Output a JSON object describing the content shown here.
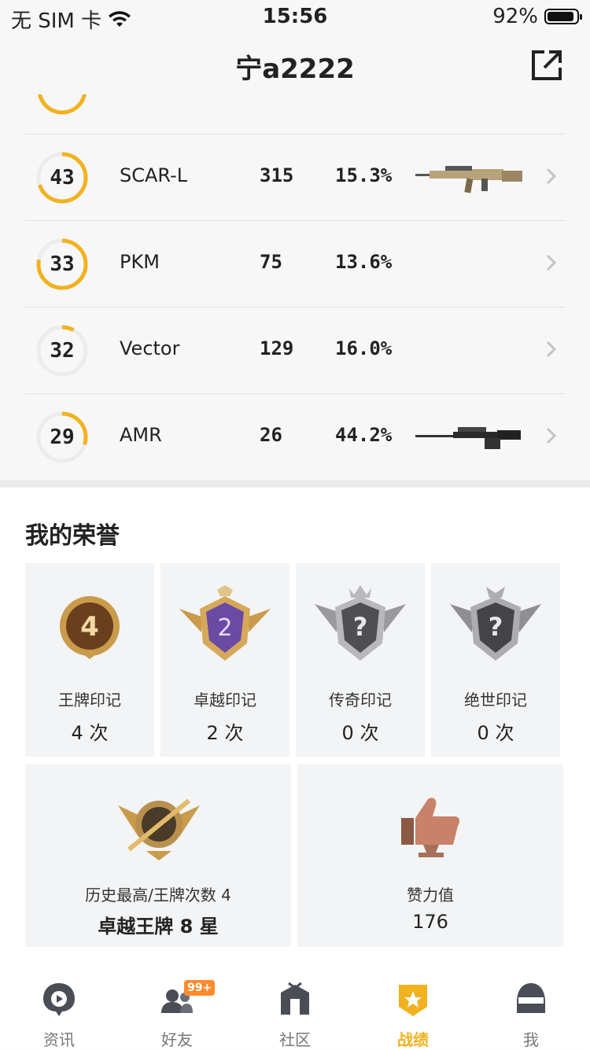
{
  "status_bar": {
    "carrier": "无 SIM 卡",
    "time": "15:56",
    "battery": "92%",
    "battery_level": 0.92
  },
  "header": {
    "title": "宁a2222"
  },
  "weapons": [
    {
      "level": "43",
      "progress": 0.7,
      "name": "SCAR-L",
      "count": "315",
      "rate": "15.3%",
      "has_image": true
    },
    {
      "level": "33",
      "progress": 0.78,
      "name": "PKM",
      "count": "75",
      "rate": "13.6%",
      "has_image": false
    },
    {
      "level": "32",
      "progress": 0.08,
      "name": "Vector",
      "count": "129",
      "rate": "16.0%",
      "has_image": false
    },
    {
      "level": "29",
      "progress": 0.3,
      "name": "AMR",
      "count": "26",
      "rate": "44.2%",
      "has_image": true
    }
  ],
  "honors": {
    "title": "我的荣誉",
    "marks": [
      {
        "label": "王牌印记",
        "value": "4 次",
        "badge_text": "4"
      },
      {
        "label": "卓越印记",
        "value": "2 次",
        "badge_text": "2"
      },
      {
        "label": "传奇印记",
        "value": "0 次",
        "badge_text": "?"
      },
      {
        "label": "绝世印记",
        "value": "0 次",
        "badge_text": "?"
      }
    ],
    "best": {
      "label": "历史最高/王牌次数 4",
      "value": "卓越王牌 8 星"
    },
    "likes": {
      "label": "赞力值",
      "value": "176"
    }
  },
  "tabbar": {
    "tabs": [
      {
        "label": "资讯",
        "icon": "news-icon"
      },
      {
        "label": "好友",
        "icon": "friends-icon",
        "badge": "99+"
      },
      {
        "label": "社区",
        "icon": "community-icon"
      },
      {
        "label": "战绩",
        "icon": "record-icon"
      },
      {
        "label": "我",
        "icon": "profile-icon"
      }
    ],
    "active": "战绩"
  },
  "colors": {
    "accent": "#f2b21f",
    "text": "#222222"
  }
}
